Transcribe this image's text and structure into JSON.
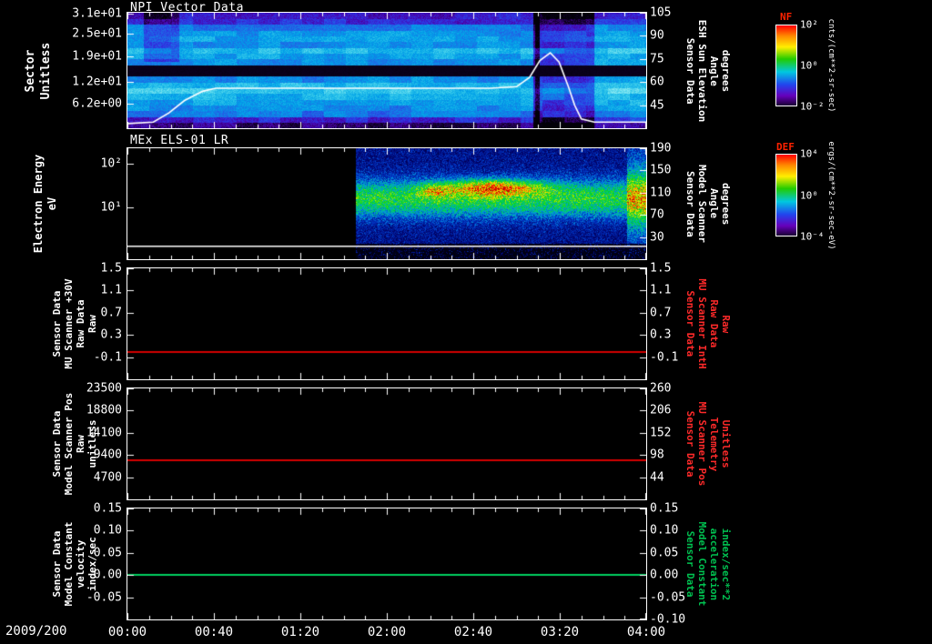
{
  "x_axis": {
    "date_label": "2009/200",
    "ticks": [
      "00:00",
      "00:40",
      "01:20",
      "02:00",
      "02:40",
      "03:20",
      "04:00"
    ]
  },
  "colors": {
    "background": "#000000",
    "axis": "#ffffff",
    "red_series": "#d40000",
    "green_series": "#00d060",
    "red_label": "#ff2a2a",
    "green_label": "#00c050",
    "colorbar_label": "#ff2200"
  },
  "chart_data": [
    {
      "type": "heatmap",
      "title": "NPI Vector Data",
      "ylabel_left": "Sector\nUnitless",
      "yticks_left": [
        "3.1e+01",
        "2.5e+01",
        "1.9e+01",
        "1.2e+01",
        "6.2e+00"
      ],
      "ytick_left_fracs": [
        0.01,
        0.18,
        0.38,
        0.6,
        0.79
      ],
      "ylabel_right": "Sensor Data\nESH Sun Elevation\nAngle\ndegrees",
      "yticks_right": [
        "105",
        "90",
        "75",
        "60",
        "45"
      ],
      "ytick_right_fracs": [
        0.0,
        0.2,
        0.4,
        0.6,
        0.8
      ],
      "right_label_color": "#ffffff",
      "colorbar": {
        "label": "NF",
        "label_color": "#ff2200",
        "units": "cnts/(cm**2-sr-sec)",
        "ticks": [
          "10²",
          "10⁰",
          "10⁻²"
        ]
      },
      "overlay_line": {
        "name": "esh-sun-elevation-angle",
        "color": "#ffffff",
        "units": "degrees",
        "right_axis_value_at_top": 105,
        "right_axis_value_at_frac_08": 45,
        "points": [
          [
            0,
            33
          ],
          [
            0.05,
            34
          ],
          [
            0.08,
            40
          ],
          [
            0.11,
            48
          ],
          [
            0.145,
            54
          ],
          [
            0.17,
            56
          ],
          [
            0.45,
            56
          ],
          [
            0.7,
            56
          ],
          [
            0.75,
            57
          ],
          [
            0.775,
            63
          ],
          [
            0.795,
            74
          ],
          [
            0.815,
            79
          ],
          [
            0.832,
            73
          ],
          [
            0.85,
            57
          ],
          [
            0.862,
            45
          ],
          [
            0.875,
            36
          ],
          [
            0.9,
            34
          ],
          [
            1,
            34
          ]
        ]
      }
    },
    {
      "type": "heatmap",
      "title": "MEx ELS-01 LR",
      "ylabel_left": "Electron Energy\neV",
      "yticks_left": [
        "10²",
        "10¹"
      ],
      "ytick_left_fracs": [
        0.14,
        0.53
      ],
      "ylabel_right": "Sensor Data\nModel Scanner\nAngle\ndegrees",
      "yticks_right": [
        "190",
        "150",
        "110",
        "70",
        "30"
      ],
      "ytick_right_fracs": [
        0.0,
        0.2,
        0.4,
        0.6,
        0.8
      ],
      "right_label_color": "#ffffff",
      "colorbar": {
        "label": "DEF",
        "label_color": "#ff2200",
        "units": "ergs/(cm**2-sr-sec-eV)",
        "ticks": [
          "10⁴",
          "10⁰",
          "10⁻⁴"
        ]
      },
      "overlay_line": {
        "name": "constant-energy-line",
        "color": "#ffffff",
        "value_ev": 1.3
      },
      "data_start_frac": 0.44
    },
    {
      "type": "line",
      "ylabel_left": "Sensor Data\nMU Scanner +30V\nRaw Data\nRaw",
      "yticks_left": [
        "1.5",
        "1.1",
        "0.7",
        "0.3",
        "-0.1"
      ],
      "ytick_left_fracs": [
        0.0,
        0.2,
        0.4,
        0.6,
        0.8
      ],
      "ylabel_right": "Sensor Data\nMU Scanner IntH\nRaw Data\nRaw",
      "yticks_right": [
        "1.5",
        "1.1",
        "0.7",
        "0.3",
        "-0.1"
      ],
      "ytick_right_fracs": [
        0.0,
        0.2,
        0.4,
        0.6,
        0.8
      ],
      "right_label_color": "#ff2a2a",
      "series": {
        "name": "mu-scanner-plus30v-raw",
        "color": "#d40000",
        "constant_value": 0.0,
        "axis_value_at_frac_0": 1.5,
        "axis_value_at_frac_08": -0.1
      }
    },
    {
      "type": "line",
      "ylabel_left": "Sensor Data\nModel Scanner Pos\nRaw\nunitless",
      "yticks_left": [
        "23500",
        "18800",
        "14100",
        "9400",
        "4700"
      ],
      "ytick_left_fracs": [
        0.0,
        0.2,
        0.4,
        0.6,
        0.8
      ],
      "ylabel_right": "Sensor Data\nMU Scanner Pos\nTelemetry\nUnitless",
      "yticks_right": [
        "260",
        "206",
        "152",
        "98",
        "44"
      ],
      "ytick_right_fracs": [
        0.0,
        0.2,
        0.4,
        0.6,
        0.8
      ],
      "right_label_color": "#ff2a2a",
      "series": {
        "name": "model-scanner-pos-raw",
        "color": "#d40000",
        "constant_value": 8200,
        "axis_value_at_frac_0": 23500,
        "axis_value_at_frac_08": 4700
      }
    },
    {
      "type": "line",
      "ylabel_left": "Sensor Data\nModel Constant\nvelocity\nindex/sec",
      "yticks_left": [
        "0.15",
        "0.10",
        "0.05",
        "0.00",
        "-0.05"
      ],
      "ytick_left_fracs": [
        0.0,
        0.2,
        0.4,
        0.6,
        0.8
      ],
      "ylabel_right": "Sensor Data\nModel Constant\nacceleration\nindex/sec**2",
      "yticks_right": [
        "0.15",
        "0.10",
        "0.05",
        "0.00",
        "-0.05",
        "-0.10"
      ],
      "ytick_right_fracs": [
        0.0,
        0.2,
        0.4,
        0.6,
        0.8,
        1.0
      ],
      "right_label_color": "#00c050",
      "series": {
        "name": "model-constant-velocity",
        "color": "#00d060",
        "constant_value": 0.0,
        "axis_value_at_frac_0": 0.15,
        "axis_value_at_frac_08": -0.05
      }
    }
  ]
}
